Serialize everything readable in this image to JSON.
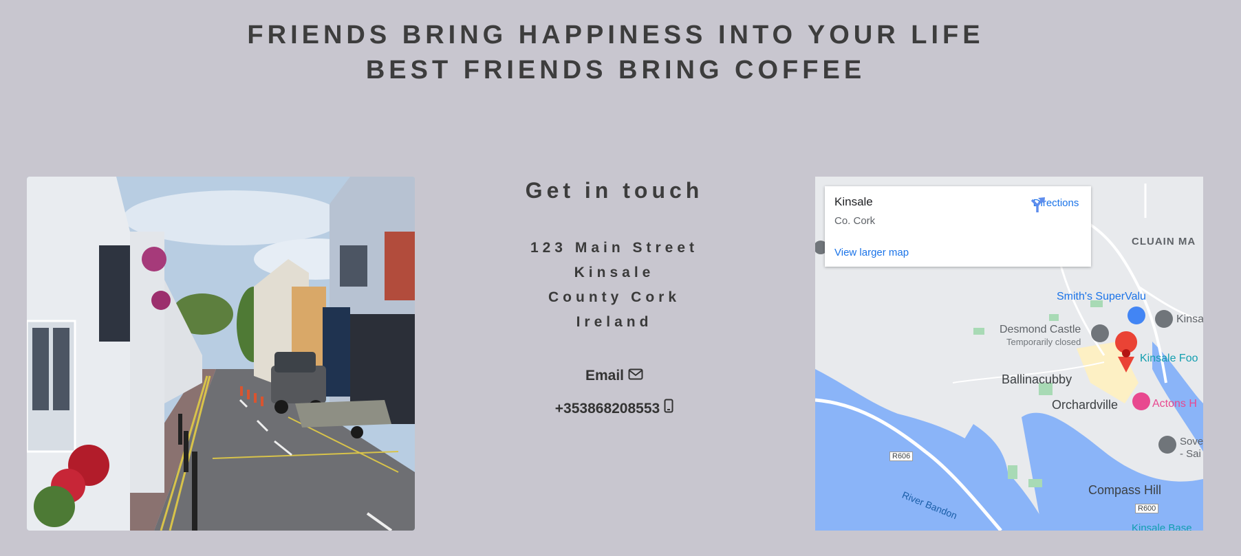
{
  "banner": {
    "line1": "FRIENDS BRING HAPPINESS INTO YOUR LIFE",
    "line2": "BEST FRIENDS BRING COFFEE"
  },
  "contact": {
    "heading": "Get in touch",
    "address": [
      "123 Main Street",
      "Kinsale",
      "County Cork",
      "Ireland"
    ],
    "email_label": "Email",
    "phone": "+353868208553"
  },
  "map": {
    "card": {
      "title": "Kinsale",
      "subtitle": "Co. Cork",
      "directions": "Directions",
      "view_larger": "View larger map"
    },
    "labels": {
      "cluain": "CLUAIN MA",
      "supervalu": "Smith's SuperValu",
      "kinsa": "Kinsa",
      "desmond": "Desmond Castle",
      "closed": "Temporarily closed",
      "kinsale_food": "Kinsale Foo",
      "ballinacubby": "Ballinacubby",
      "orchardville": "Orchardville",
      "actons": "Actons H",
      "sove": "Sove",
      "sai": "- Sai",
      "r606": "R606",
      "compass": "Compass Hill",
      "r600": "R600",
      "river": "River Bandon",
      "kinsale_base": "Kinsale Base"
    }
  }
}
